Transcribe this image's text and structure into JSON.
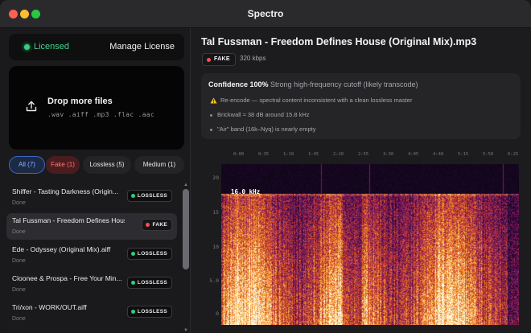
{
  "window": {
    "title": "Spectro"
  },
  "sidebar": {
    "license": {
      "status": "Licensed",
      "action": "Manage License"
    },
    "drop_zone": {
      "title": "Drop more files",
      "extensions": ".wav .aiff .mp3 .flac .aac"
    },
    "filters": [
      {
        "label": "All (7)",
        "active": true
      },
      {
        "label": "Fake (1)",
        "active": false
      },
      {
        "label": "Lossless (5)",
        "active": false
      },
      {
        "label": "Medium (1)",
        "active": false
      }
    ],
    "files": [
      {
        "name": "Shiffer - Tasting Darkness (Origin...",
        "status": "Done",
        "badge": "LOSSLESS",
        "badge_type": "lossless",
        "selected": false
      },
      {
        "name": "Tal Fussman - Freedom Defines Hous...",
        "status": "Done",
        "badge": "FAKE",
        "badge_type": "fake",
        "selected": true
      },
      {
        "name": "Ede - Odyssey (Original Mix).aiff",
        "status": "Done",
        "badge": "LOSSLESS",
        "badge_type": "lossless",
        "selected": false
      },
      {
        "name": "Cloonee & Prospa - Free Your Min...",
        "status": "Done",
        "badge": "LOSSLESS",
        "badge_type": "lossless",
        "selected": false
      },
      {
        "name": "Tri/xon - WORK/OUT.aiff",
        "status": "Done",
        "badge": "LOSSLESS",
        "badge_type": "lossless",
        "selected": false
      }
    ]
  },
  "main": {
    "file_title": "Tal Fussman - Freedom Defines House (Original Mix).mp3",
    "verdict": "FAKE",
    "bitrate": "320 kbps",
    "analysis": {
      "confidence_label": "Confidence 100%",
      "confidence_desc": "Strong high-frequency cutoff (likely transcode)",
      "findings": [
        {
          "text": "Re-encode — spectral content inconsistent with a clean lossless master",
          "icon": "warning-icon"
        },
        {
          "text": "Brickwall ≈ 38 dB around 15.8 kHz",
          "icon": "bullet"
        },
        {
          "text": "\"Air\" band (16k–Nyq) is nearly empty",
          "icon": "bullet"
        }
      ]
    },
    "spectrogram": {
      "time_ticks": [
        "0:00",
        "0:35",
        "1:10",
        "1:45",
        "2:20",
        "2:55",
        "3:30",
        "4:05",
        "4:40",
        "5:15",
        "5:50",
        "6:25"
      ],
      "freq_ticks": [
        "20",
        "15",
        "10",
        "5.0",
        "0"
      ],
      "cutoff_label": "16.0 kHz",
      "freq_max_khz": 22,
      "cutoff_khz": 16,
      "colormap": "inferno"
    }
  }
}
